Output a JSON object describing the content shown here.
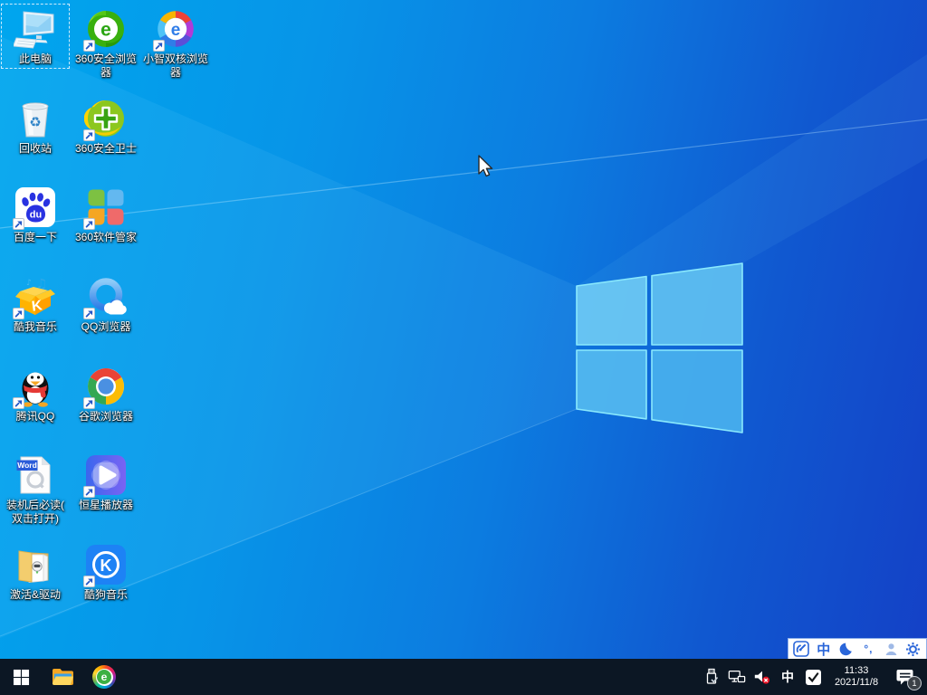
{
  "desktop": {
    "icons": [
      {
        "name": "this-pc",
        "label": "此电脑",
        "kind": "this-pc",
        "col": 0,
        "row": 0,
        "shortcut": false,
        "selected": true
      },
      {
        "name": "recycle-bin",
        "label": "回收站",
        "kind": "recycle-bin",
        "col": 0,
        "row": 1,
        "shortcut": false,
        "selected": false
      },
      {
        "name": "baidu-search",
        "label": "百度一下",
        "kind": "baidu",
        "col": 0,
        "row": 2,
        "shortcut": true,
        "selected": false
      },
      {
        "name": "kuwo-music",
        "label": "酷我音乐",
        "kind": "kuwo",
        "col": 0,
        "row": 3,
        "shortcut": true,
        "selected": false
      },
      {
        "name": "tencent-qq",
        "label": "腾讯QQ",
        "kind": "qq",
        "col": 0,
        "row": 4,
        "shortcut": true,
        "selected": false
      },
      {
        "name": "readme-after-install",
        "label": "装机后必读(\n双击打开)",
        "kind": "word",
        "col": 0,
        "row": 5,
        "shortcut": false,
        "selected": false
      },
      {
        "name": "activation-and-drivers",
        "label": "激活&驱动",
        "kind": "folder",
        "col": 0,
        "row": 6,
        "shortcut": false,
        "selected": false
      },
      {
        "name": "360-secure-browser",
        "label": "360安全浏览\n器",
        "kind": "se360",
        "col": 1,
        "row": 0,
        "shortcut": true,
        "selected": false
      },
      {
        "name": "360-safeguard",
        "label": "360安全卫士",
        "kind": "safe360",
        "col": 1,
        "row": 1,
        "shortcut": true,
        "selected": false
      },
      {
        "name": "360-software-manager",
        "label": "360软件管家",
        "kind": "sw360",
        "col": 1,
        "row": 2,
        "shortcut": true,
        "selected": false
      },
      {
        "name": "qq-browser",
        "label": "QQ浏览器",
        "kind": "qqbrowser",
        "col": 1,
        "row": 3,
        "shortcut": true,
        "selected": false
      },
      {
        "name": "google-chrome",
        "label": "谷歌浏览器",
        "kind": "chrome",
        "col": 1,
        "row": 4,
        "shortcut": true,
        "selected": false
      },
      {
        "name": "hengxing-player",
        "label": "恒星播放器",
        "kind": "hengxing",
        "col": 1,
        "row": 5,
        "shortcut": true,
        "selected": false
      },
      {
        "name": "kugou-music",
        "label": "酷狗音乐",
        "kind": "kugou",
        "col": 1,
        "row": 6,
        "shortcut": true,
        "selected": false
      },
      {
        "name": "xiaozhi-dual-core-browser",
        "label": "小智双核浏览\n器",
        "kind": "xiaozhi",
        "col": 2,
        "row": 0,
        "shortcut": true,
        "selected": false
      }
    ]
  },
  "langbar": {
    "mode_label": "中",
    "punct_label": "°,"
  },
  "taskbar": {
    "browser_e_label": "e",
    "tray": {
      "ime_indicator": "中",
      "clock": {
        "time": "11:33",
        "date": "2021/11/8"
      },
      "notification_count": "1"
    }
  },
  "colors": {
    "wallpaper_left": "#00a6ee",
    "wallpaper_right": "#1440c6",
    "taskbar_bg": "#0c1724",
    "langbar_accent": "#2a66d9",
    "selection_dash": "#f0f8ff"
  }
}
